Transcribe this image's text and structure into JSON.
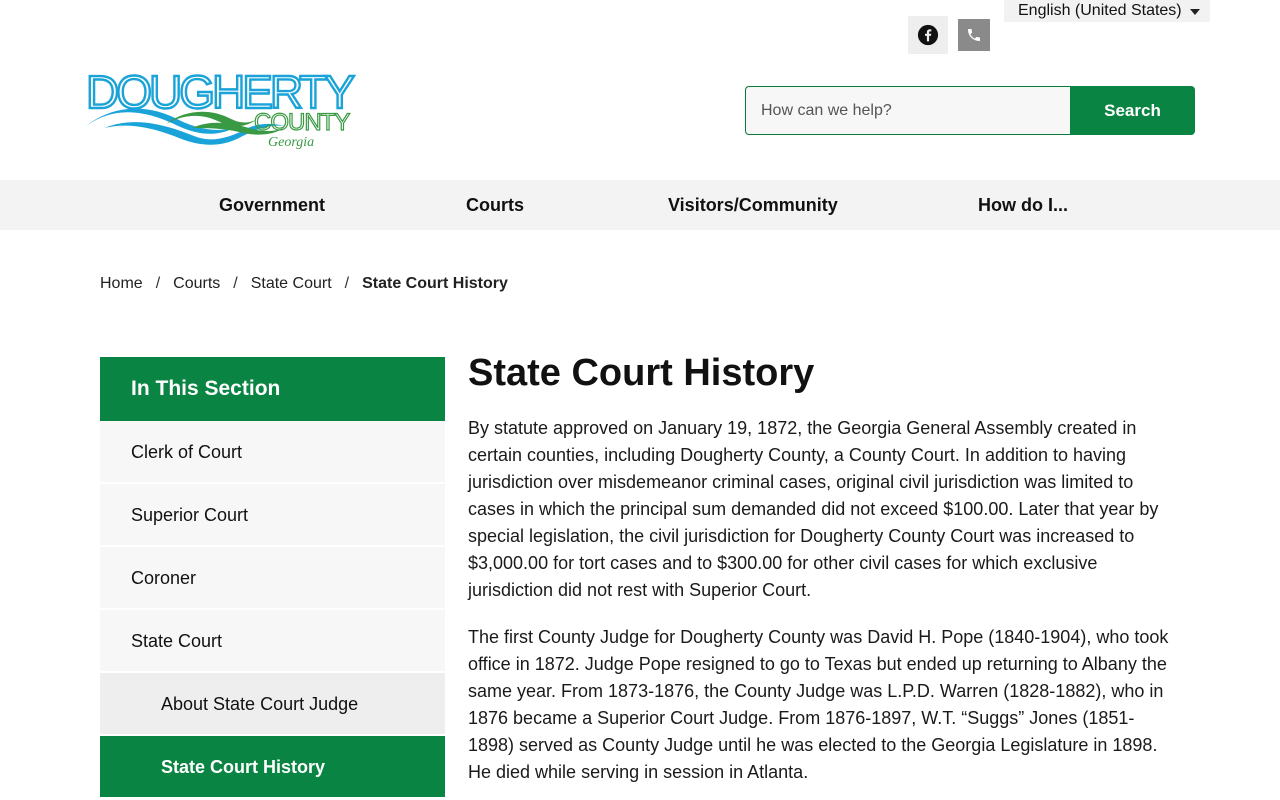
{
  "topbar": {
    "language": "English (United States)",
    "social": [
      {
        "name": "facebook-icon"
      },
      {
        "name": "phone-icon"
      }
    ]
  },
  "logo": {
    "line1": "DOUGHERTY",
    "line2": "COUNTY",
    "line3": "Georgia",
    "colors": {
      "blue": "#1aa3d9",
      "green": "#3a9a44"
    }
  },
  "search": {
    "placeholder": "How can we help?",
    "button_label": "Search"
  },
  "nav": {
    "items": [
      {
        "label": "Government"
      },
      {
        "label": "Courts"
      },
      {
        "label": "Visitors/Community"
      },
      {
        "label": "How do I..."
      }
    ]
  },
  "breadcrumb": {
    "items": [
      "Home",
      "Courts",
      "State Court"
    ],
    "current": "State Court History",
    "separator": "/"
  },
  "sidebar": {
    "heading": "In This Section",
    "items": [
      {
        "label": "Clerk of Court"
      },
      {
        "label": "Superior Court"
      },
      {
        "label": "Coroner"
      },
      {
        "label": "State Court"
      },
      {
        "label": "About State Court Judge"
      },
      {
        "label": "State Court History"
      }
    ]
  },
  "content": {
    "title": "State Court History",
    "paragraphs": [
      "By statute approved on January 19, 1872, the Georgia General Assembly created in certain counties, including Dougherty County, a County Court. In addition to having jurisdiction over misdemeanor criminal cases, original civil jurisdiction was limited to cases in which the principal sum demanded did not exceed $100.00. Later that year by special legislation, the civil jurisdiction for Dougherty County Court was increased to $3,000.00 for tort cases and to $300.00 for other civil cases for which exclusive jurisdiction did not rest with Superior Court.",
      "The first County Judge for Dougherty County was David H. Pope (1840-1904), who took office in 1872. Judge Pope resigned to go to Texas but ended up returning to Albany the same year. From 1873-1876, the County Judge was L.P.D. Warren (1828-1882), who in 1876 became a Superior Court Judge. From 1876-1897, W.T. “Suggs” Jones (1851-1898) served as County Judge until he was elected to the Georgia Legislature in 1898. He died while serving in session in Atlanta."
    ]
  },
  "colors": {
    "brand_green": "#0a8443",
    "nav_bg": "#f3f3f3",
    "sidebar_bg": "#f7f7f7"
  }
}
